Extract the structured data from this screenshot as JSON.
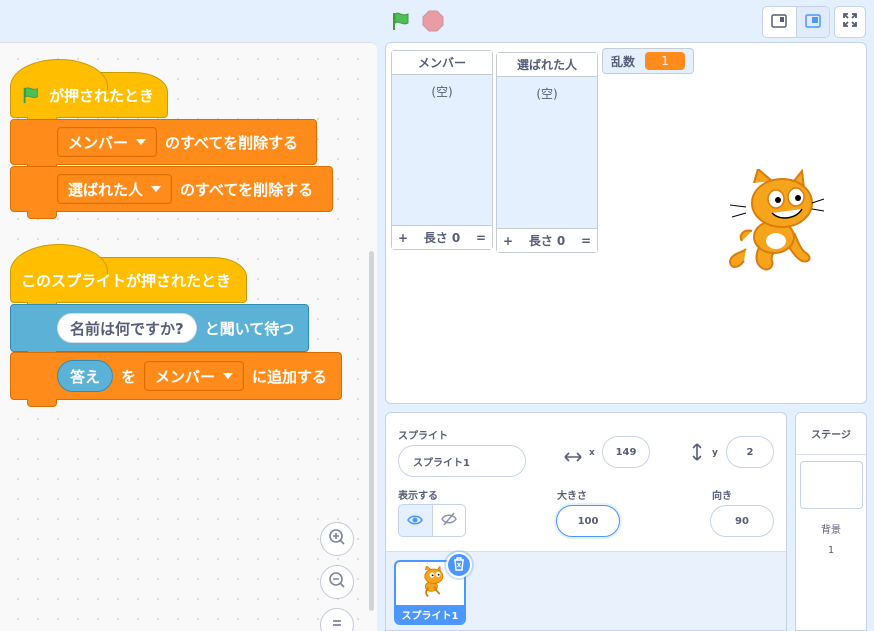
{
  "toolbar": {
    "green_flag_icon": "green-flag-icon",
    "stop_icon": "stop-icon",
    "small_stage_icon": "small-stage-icon",
    "normal_stage_icon": "normal-stage-icon",
    "fullscreen_icon": "fullscreen-icon"
  },
  "scripts": {
    "script1": {
      "hat_label": "が押されたとき",
      "block1": {
        "dropdown": "メンバー",
        "text": "のすべてを削除する"
      },
      "block2": {
        "dropdown": "選ばれた人",
        "text": "のすべてを削除する"
      }
    },
    "script2": {
      "hat_label": "このスプライトが押されたとき",
      "ask": {
        "input": "名前は何ですか?",
        "text": "と聞いて待つ"
      },
      "add": {
        "reporter": "答え",
        "text1": "を",
        "dropdown": "メンバー",
        "text2": "に追加する"
      }
    }
  },
  "stage": {
    "lists": [
      {
        "title": "メンバー",
        "empty": "(空)",
        "plus": "+",
        "length": "長さ 0",
        "eq": "="
      },
      {
        "title": "選ばれた人",
        "empty": "(空)",
        "plus": "+",
        "length": "長さ 0",
        "eq": "="
      }
    ],
    "variable": {
      "name": "乱数",
      "value": "1"
    }
  },
  "sprite_info": {
    "sprite_label": "スプライト",
    "name": "スプライト1",
    "x_label": "x",
    "x": "149",
    "y_label": "y",
    "y": "2",
    "show_label": "表示する",
    "size_label": "大きさ",
    "size": "100",
    "direction_label": "向き",
    "direction": "90"
  },
  "sprites": [
    {
      "name": "スプライト1"
    }
  ],
  "stage_selector": {
    "title": "ステージ",
    "backdrops_label": "背景",
    "backdrops_count": "1"
  },
  "colors": {
    "motion_blue": "#4c97ff",
    "events_yellow": "#ffbf00",
    "variables_orange": "#ff8c1a",
    "sensing_blue": "#5cb1d6"
  }
}
